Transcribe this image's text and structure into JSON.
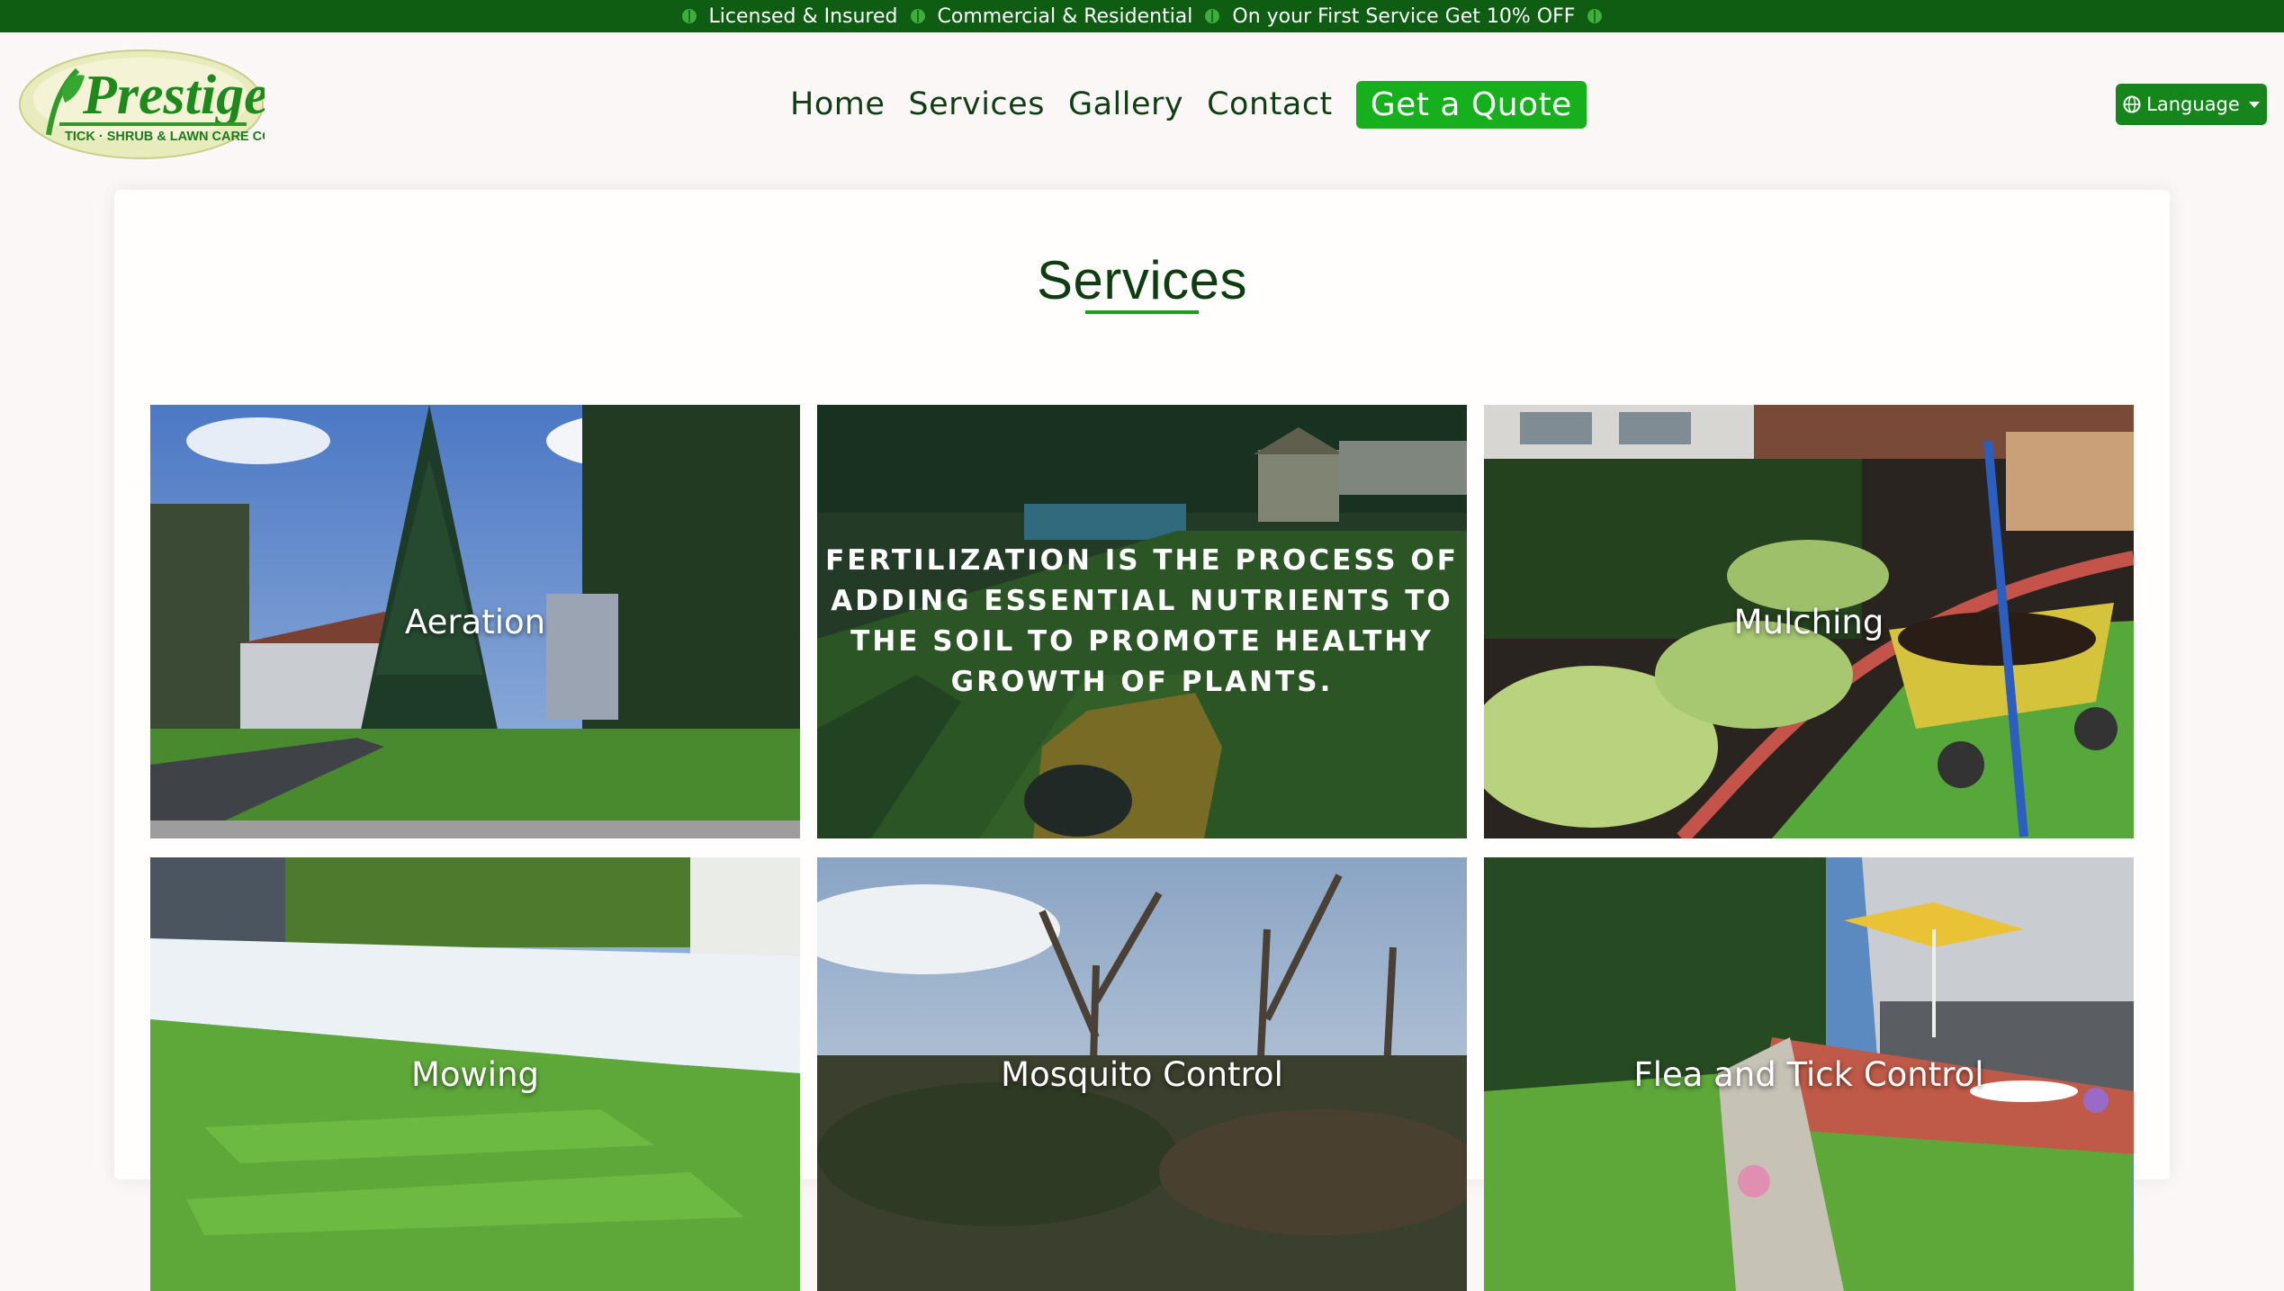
{
  "topbar": {
    "items": [
      "Licensed & Insured",
      "Commercial & Residential",
      "On your First Service Get 10% OFF"
    ]
  },
  "logo": {
    "wordmark": "Prestige",
    "tagline": "TICK · SHRUB & LAWN CARE CORP"
  },
  "nav": {
    "home": "Home",
    "services": "Services",
    "gallery": "Gallery",
    "contact": "Contact",
    "quote": "Get a Quote"
  },
  "language": {
    "label": "Language",
    "icon": "globe-icon"
  },
  "main": {
    "title": "Services",
    "tiles": [
      {
        "label": "Aeration"
      },
      {
        "label": "Fertilization",
        "description": "Fertilization is the process of adding essential nutrients to the soil to promote healthy growth of plants."
      },
      {
        "label": "Mulching"
      },
      {
        "label": "Mowing"
      },
      {
        "label": "Mosquito Control"
      },
      {
        "label": "Flea and Tick Control"
      }
    ]
  },
  "colors": {
    "topbar": "#0e5d12",
    "accent": "#16b01c",
    "heading": "#0f3d12",
    "language_button": "#16861c"
  }
}
